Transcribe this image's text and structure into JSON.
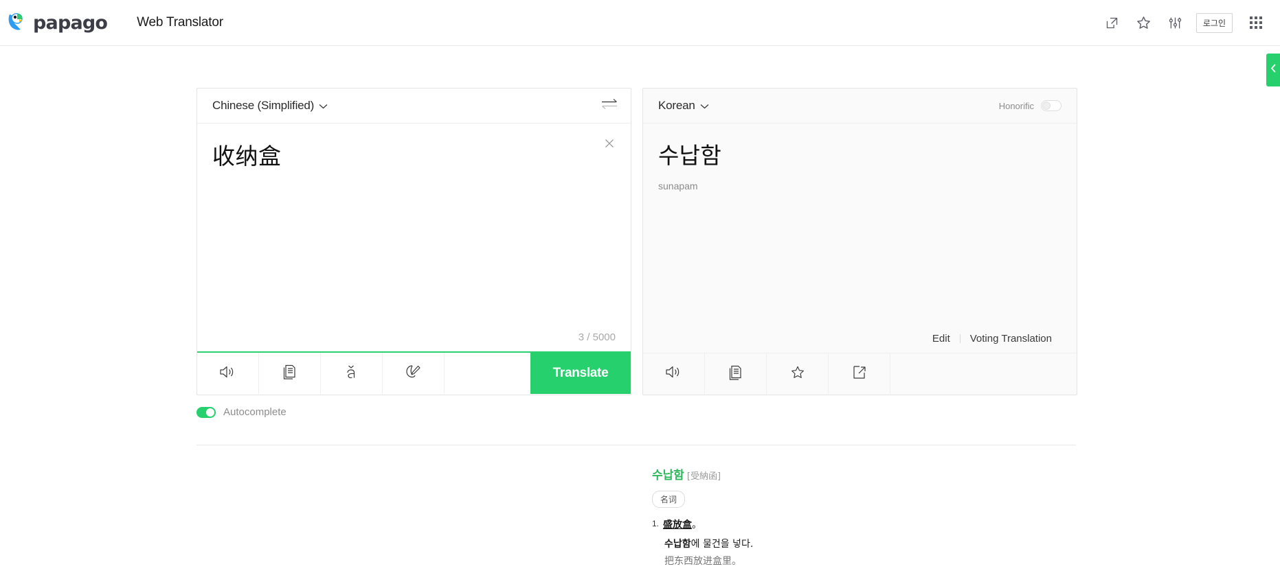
{
  "header": {
    "logo_text": "papago",
    "app_title": "Web Translator",
    "icons": [
      {
        "name": "share-external-icon"
      },
      {
        "name": "star-icon"
      },
      {
        "name": "sliders-settings-icon"
      }
    ],
    "login_label": "로그인",
    "apps_grid_icon": "apps-grid-icon"
  },
  "side_tab": {
    "name": "expand-panel-tab",
    "icon": "chevron-left-icon",
    "color": "#26d06d"
  },
  "source_panel": {
    "language": "Chinese (Simplified)",
    "text": "收纳盒",
    "counter": "3 / 5000",
    "clear_icon": "close-icon",
    "swap_icon": "swap-languages-icon",
    "tools": [
      {
        "name": "listen-icon",
        "label": "Listen"
      },
      {
        "name": "copy-icon",
        "label": "Copy"
      },
      {
        "name": "pinyin-icon",
        "label": "ǎ"
      },
      {
        "name": "handwriting-icon",
        "label": "Handwriting"
      }
    ],
    "translate_label": "Translate"
  },
  "target_panel": {
    "language": "Korean",
    "honorific_label": "Honorific",
    "honorific_on": false,
    "text": "수납함",
    "romanization": "sunapam",
    "edit_label": "Edit",
    "voting_label": "Voting Translation",
    "tools": [
      {
        "name": "listen-icon",
        "label": "Listen"
      },
      {
        "name": "copy-icon",
        "label": "Copy"
      },
      {
        "name": "favorite-star-icon",
        "label": "Favorite"
      },
      {
        "name": "share-icon",
        "label": "Share"
      }
    ]
  },
  "autocomplete": {
    "label": "Autocomplete",
    "enabled": true
  },
  "dictionary": {
    "headword": "수납함",
    "hanja": "[受納函]",
    "pos": "名词",
    "senses": [
      {
        "number": "1.",
        "definition": "盛放盒",
        "punct": "。",
        "example_ko_bold": "수납함",
        "example_ko_rest": "에 물건을 넣다.",
        "example_zh": "把东西放进盒里。"
      }
    ]
  },
  "colors": {
    "accent_green": "#26d06d",
    "dict_green": "#2eb85c"
  }
}
